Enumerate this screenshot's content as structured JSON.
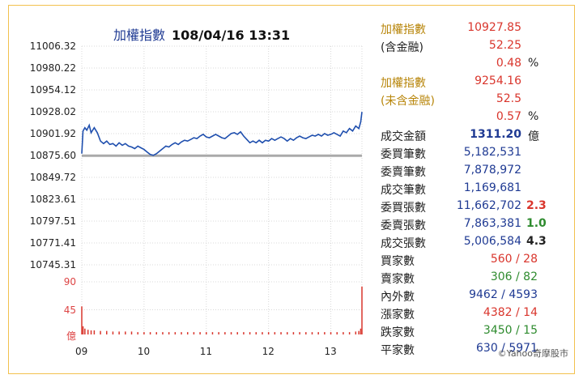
{
  "chart": {
    "title_name": "加權指數",
    "title_datetime": "108/04/16 13:31",
    "price_ticks": [
      "11006.32",
      "10980.22",
      "10954.12",
      "10928.02",
      "10901.92",
      "10875.60",
      "10849.72",
      "10823.61",
      "10797.51",
      "10771.41",
      "10745.31"
    ],
    "volume_ticks": [
      "90",
      "45",
      "億"
    ],
    "time_ticks": [
      "09",
      "10",
      "11",
      "12",
      "13"
    ]
  },
  "chart_data": {
    "type": "line",
    "title": "加權指數 108/04/16 13:31",
    "reference_line": 10875.6,
    "ylim": [
      10745.31,
      11006.32
    ],
    "xlim": [
      9,
      13.5
    ],
    "volume_ylim": [
      0,
      90
    ],
    "series": [
      {
        "values": [
          [
            9.0,
            10878
          ],
          [
            9.02,
            10905
          ],
          [
            9.05,
            10909
          ],
          [
            9.08,
            10906
          ],
          [
            9.12,
            10912
          ],
          [
            9.15,
            10903
          ],
          [
            9.2,
            10909
          ],
          [
            9.25,
            10903
          ],
          [
            9.3,
            10893
          ],
          [
            9.35,
            10890
          ],
          [
            9.4,
            10893
          ],
          [
            9.45,
            10889
          ],
          [
            9.5,
            10890
          ],
          [
            9.55,
            10887
          ],
          [
            9.6,
            10891
          ],
          [
            9.65,
            10888
          ],
          [
            9.7,
            10890
          ],
          [
            9.75,
            10887
          ],
          [
            9.8,
            10886
          ],
          [
            9.85,
            10884
          ],
          [
            9.9,
            10887
          ],
          [
            9.95,
            10885
          ],
          [
            10.0,
            10883
          ],
          [
            10.05,
            10880
          ],
          [
            10.1,
            10877
          ],
          [
            10.15,
            10876
          ],
          [
            10.2,
            10878
          ],
          [
            10.25,
            10881
          ],
          [
            10.3,
            10884
          ],
          [
            10.35,
            10887
          ],
          [
            10.4,
            10886
          ],
          [
            10.45,
            10889
          ],
          [
            10.5,
            10891
          ],
          [
            10.55,
            10889
          ],
          [
            10.6,
            10892
          ],
          [
            10.65,
            10894
          ],
          [
            10.7,
            10893
          ],
          [
            10.75,
            10895
          ],
          [
            10.8,
            10897
          ],
          [
            10.85,
            10896
          ],
          [
            10.9,
            10899
          ],
          [
            10.95,
            10901
          ],
          [
            11.0,
            10898
          ],
          [
            11.05,
            10897
          ],
          [
            11.1,
            10899
          ],
          [
            11.15,
            10901
          ],
          [
            11.2,
            10899
          ],
          [
            11.25,
            10897
          ],
          [
            11.3,
            10896
          ],
          [
            11.35,
            10899
          ],
          [
            11.4,
            10902
          ],
          [
            11.45,
            10903
          ],
          [
            11.5,
            10901
          ],
          [
            11.55,
            10904
          ],
          [
            11.6,
            10899
          ],
          [
            11.65,
            10895
          ],
          [
            11.7,
            10891
          ],
          [
            11.75,
            10893
          ],
          [
            11.8,
            10891
          ],
          [
            11.85,
            10894
          ],
          [
            11.9,
            10891
          ],
          [
            11.95,
            10894
          ],
          [
            12.0,
            10893
          ],
          [
            12.05,
            10896
          ],
          [
            12.1,
            10894
          ],
          [
            12.15,
            10896
          ],
          [
            12.2,
            10898
          ],
          [
            12.25,
            10896
          ],
          [
            12.3,
            10893
          ],
          [
            12.35,
            10896
          ],
          [
            12.4,
            10894
          ],
          [
            12.45,
            10897
          ],
          [
            12.5,
            10899
          ],
          [
            12.55,
            10897
          ],
          [
            12.6,
            10896
          ],
          [
            12.65,
            10898
          ],
          [
            12.7,
            10900
          ],
          [
            12.75,
            10899
          ],
          [
            12.8,
            10901
          ],
          [
            12.85,
            10899
          ],
          [
            12.9,
            10902
          ],
          [
            12.95,
            10900
          ],
          [
            13.0,
            10901
          ],
          [
            13.05,
            10903
          ],
          [
            13.1,
            10901
          ],
          [
            13.15,
            10899
          ],
          [
            13.2,
            10905
          ],
          [
            13.25,
            10903
          ],
          [
            13.3,
            10908
          ],
          [
            13.35,
            10905
          ],
          [
            13.4,
            10911
          ],
          [
            13.45,
            10908
          ],
          [
            13.48,
            10916
          ],
          [
            13.5,
            10927.85
          ]
        ]
      }
    ],
    "volume": [
      [
        9.0,
        48
      ],
      [
        9.02,
        14
      ],
      [
        9.05,
        10
      ],
      [
        9.1,
        8
      ],
      [
        9.15,
        7
      ],
      [
        9.2,
        7
      ],
      [
        9.3,
        6
      ],
      [
        9.4,
        6
      ],
      [
        9.5,
        5
      ],
      [
        9.6,
        5
      ],
      [
        9.7,
        5
      ],
      [
        9.8,
        5
      ],
      [
        9.9,
        4
      ],
      [
        10.0,
        4
      ],
      [
        10.1,
        4
      ],
      [
        10.2,
        4
      ],
      [
        10.3,
        4
      ],
      [
        10.4,
        4
      ],
      [
        10.5,
        4
      ],
      [
        10.6,
        4
      ],
      [
        10.7,
        4
      ],
      [
        10.8,
        4
      ],
      [
        10.9,
        4
      ],
      [
        11.0,
        4
      ],
      [
        11.1,
        4
      ],
      [
        11.2,
        4
      ],
      [
        11.3,
        4
      ],
      [
        11.4,
        4
      ],
      [
        11.5,
        4
      ],
      [
        11.6,
        4
      ],
      [
        11.7,
        4
      ],
      [
        11.8,
        4
      ],
      [
        11.9,
        4
      ],
      [
        12.0,
        4
      ],
      [
        12.1,
        4
      ],
      [
        12.2,
        4
      ],
      [
        12.3,
        4
      ],
      [
        12.4,
        4
      ],
      [
        12.5,
        4
      ],
      [
        12.6,
        4
      ],
      [
        12.7,
        4
      ],
      [
        12.8,
        4
      ],
      [
        12.9,
        4
      ],
      [
        13.0,
        4
      ],
      [
        13.1,
        4
      ],
      [
        13.2,
        4
      ],
      [
        13.3,
        4
      ],
      [
        13.4,
        5
      ],
      [
        13.45,
        6
      ],
      [
        13.48,
        10
      ],
      [
        13.5,
        82
      ]
    ]
  },
  "stats": [
    {
      "label": "加權指數",
      "label_color": "#b8860b",
      "value": "10927.85",
      "value_color": "#d9352c"
    },
    {
      "label": "(含金融)",
      "label_color": "#222222",
      "value": "52.25",
      "value_color": "#d9352c"
    },
    {
      "label": "",
      "label_color": "#222222",
      "value": "0.48",
      "value_color": "#d9352c",
      "ext": "%",
      "ext_color": "#222222"
    },
    {
      "label": "加權指數",
      "label_color": "#b8860b",
      "value": "9254.16",
      "value_color": "#d9352c"
    },
    {
      "label": "(未含金融)",
      "label_color": "#b8860b",
      "value": "52.5",
      "value_color": "#d9352c"
    },
    {
      "label": "",
      "label_color": "#222222",
      "value": "0.57",
      "value_color": "#d9352c",
      "ext": "%",
      "ext_color": "#222222"
    },
    {
      "label": "成交金額",
      "label_color": "#222222",
      "value": "1311.20",
      "value_color": "#1f3a93",
      "ext": "億",
      "ext_color": "#222222",
      "bold": true
    },
    {
      "label": "委買筆數",
      "label_color": "#222222",
      "value": "5,182,531",
      "value_color": "#1f3a93"
    },
    {
      "label": "委賣筆數",
      "label_color": "#222222",
      "value": "7,878,972",
      "value_color": "#1f3a93"
    },
    {
      "label": "成交筆數",
      "label_color": "#222222",
      "value": "1,169,681",
      "value_color": "#1f3a93"
    },
    {
      "label": "委買張數",
      "label_color": "#222222",
      "value": "11,662,702",
      "value_color": "#1f3a93",
      "ext": "2.3",
      "ext_color": "#d9352c"
    },
    {
      "label": "委賣張數",
      "label_color": "#222222",
      "value": "7,863,381",
      "value_color": "#1f3a93",
      "ext": "1.0",
      "ext_color": "#2e8b2e"
    },
    {
      "label": "成交張數",
      "label_color": "#222222",
      "value": "5,006,584",
      "value_color": "#1f3a93",
      "ext": "4.3",
      "ext_color": "#222222"
    },
    {
      "label": "買家數",
      "label_color": "#222222",
      "value_a": "560",
      "value_b": "28",
      "color_a": "#d9352c",
      "color_b": "#d9352c"
    },
    {
      "label": "賣家數",
      "label_color": "#222222",
      "value_a": "306",
      "value_b": "82",
      "color_a": "#2e8b2e",
      "color_b": "#2e8b2e"
    },
    {
      "label": "內外數",
      "label_color": "#222222",
      "value_a": "9462",
      "value_b": "4593",
      "color_a": "#1f3a93",
      "color_b": "#1f3a93"
    },
    {
      "label": "漲家數",
      "label_color": "#222222",
      "value_a": "4382",
      "value_b": "14",
      "color_a": "#d9352c",
      "color_b": "#d9352c"
    },
    {
      "label": "跌家數",
      "label_color": "#222222",
      "value_a": "3450",
      "value_b": "15",
      "color_a": "#2e8b2e",
      "color_b": "#2e8b2e"
    },
    {
      "label": "平家數",
      "label_color": "#222222",
      "value_a": "630",
      "value_b": "5971",
      "color_a": "#1f3a93",
      "color_b": "#1f3a93"
    }
  ],
  "footer": "©Yahoo奇摩股市",
  "colors": {
    "line": "#1f4fae",
    "reference": "#aaaaaa",
    "volume": "#d9352c",
    "border": "#f2c14e"
  }
}
